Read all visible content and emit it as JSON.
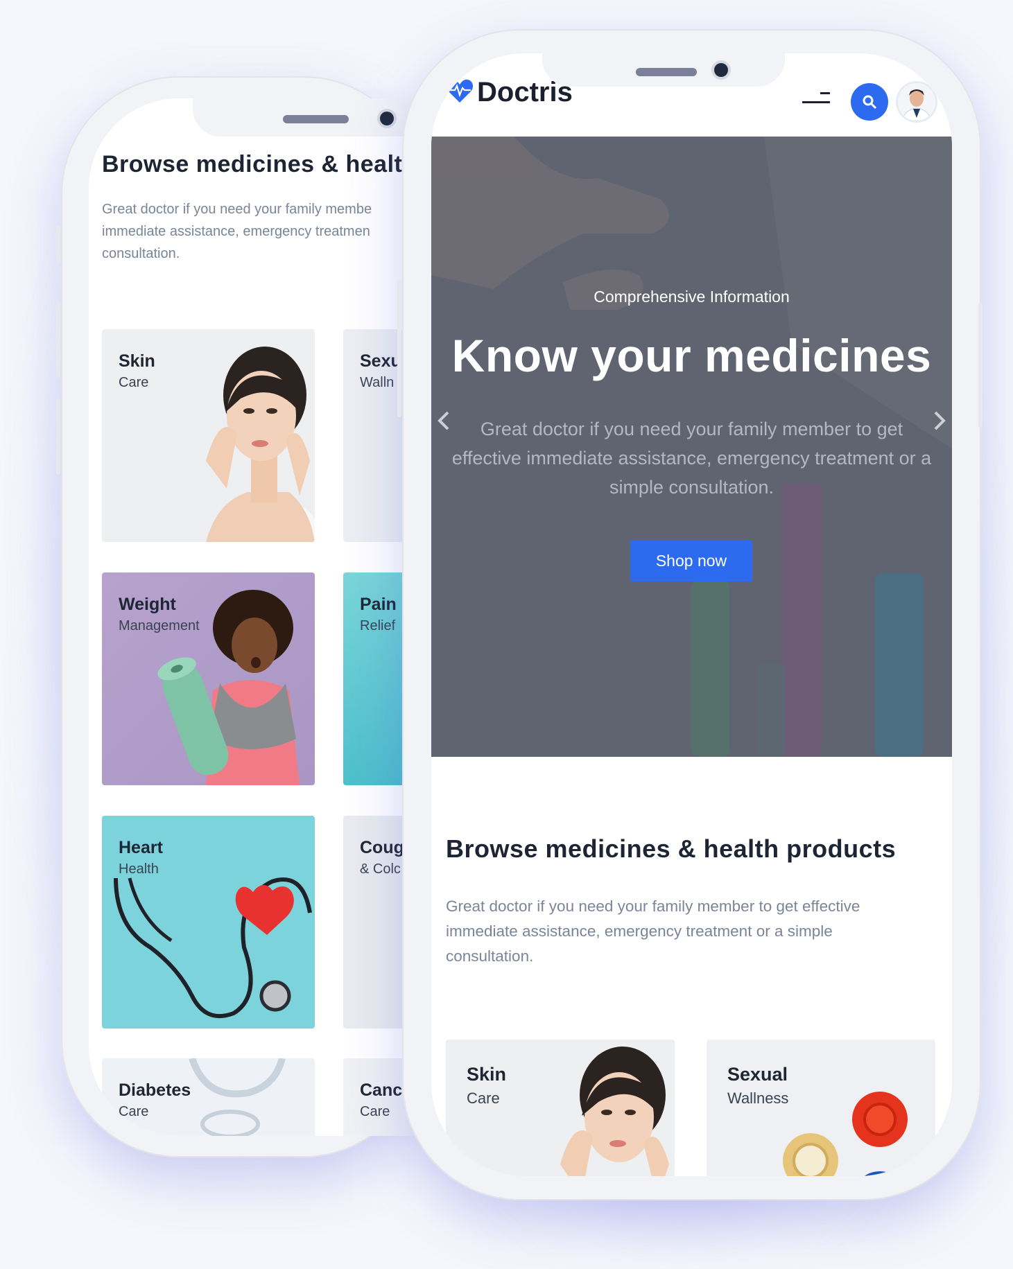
{
  "colors": {
    "accent": "#2c6bf0",
    "hero_overlay": "#5f6470",
    "card_weight": "#b49fca",
    "card_heart": "#78d3dc",
    "card_pain": "#6fcfd6",
    "card_light": "#eceef2"
  },
  "back_phone": {
    "section": {
      "title": "Browse medicines & healt",
      "description": "Great doctor if you need your family membe immediate assistance, emergency treatmen consultation."
    },
    "cards": [
      {
        "title": "Skin",
        "subtitle": "Care"
      },
      {
        "title": "Sexu",
        "subtitle": "Walln"
      },
      {
        "title": "Weight",
        "subtitle": "Management"
      },
      {
        "title": "Pain",
        "subtitle": "Relief"
      },
      {
        "title": "Heart",
        "subtitle": "Health"
      },
      {
        "title": "Coug",
        "subtitle": "& Colc"
      },
      {
        "title": "Diabetes",
        "subtitle": "Care"
      },
      {
        "title": "Canc",
        "subtitle": "Care"
      }
    ]
  },
  "front_phone": {
    "header": {
      "brand": "Doctris",
      "search_icon": "search-icon",
      "menu_icon": "hamburger-icon",
      "avatar": "doctor-avatar"
    },
    "hero": {
      "kicker": "Comprehensive Information",
      "title": "Know your medicines",
      "description": "Great doctor if you need your family member to get effective immediate assistance, emergency treatment or a simple consultation.",
      "cta": "Shop now",
      "prev_icon": "chevron-left-icon",
      "next_icon": "chevron-right-icon"
    },
    "section": {
      "title": "Browse medicines & health products",
      "description": "Great doctor if you need your family member to get effective immediate assistance, emergency treatment or a simple consultation."
    },
    "cards": [
      {
        "title": "Skin",
        "subtitle": "Care"
      },
      {
        "title": "Sexual",
        "subtitle": "Wallness"
      }
    ]
  }
}
